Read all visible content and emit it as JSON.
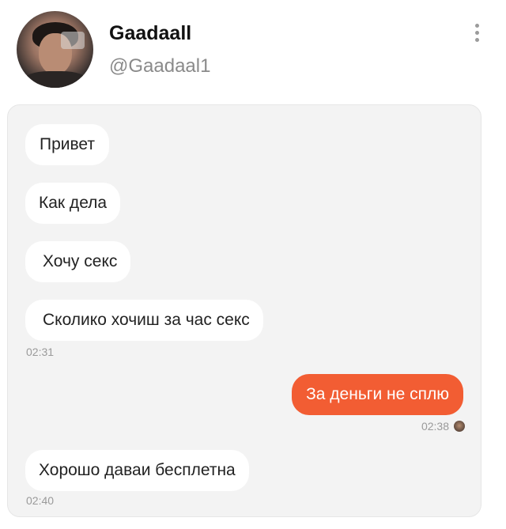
{
  "profile": {
    "display_name": "Gaadaall",
    "handle": "@Gaadaal1",
    "avatar_icon": "user-avatar-photo",
    "more_icon": "vertical-ellipsis-icon"
  },
  "colors": {
    "outgoing_bubble": "#f25d33",
    "incoming_bubble": "#ffffff",
    "chat_background": "#f3f3f3"
  },
  "messages": [
    {
      "text": "Привет",
      "direction": "incoming"
    },
    {
      "text": "Как дела",
      "direction": "incoming"
    },
    {
      "text": "Хочу секс",
      "direction": "incoming"
    },
    {
      "text": "Сколико хочиш за час секс",
      "direction": "incoming",
      "time": "02:31"
    },
    {
      "text": "За деньги не сплю",
      "direction": "outgoing",
      "time": "02:38"
    },
    {
      "text": "Хорошо даваи бесплетна",
      "direction": "incoming",
      "time": "02:40"
    }
  ]
}
